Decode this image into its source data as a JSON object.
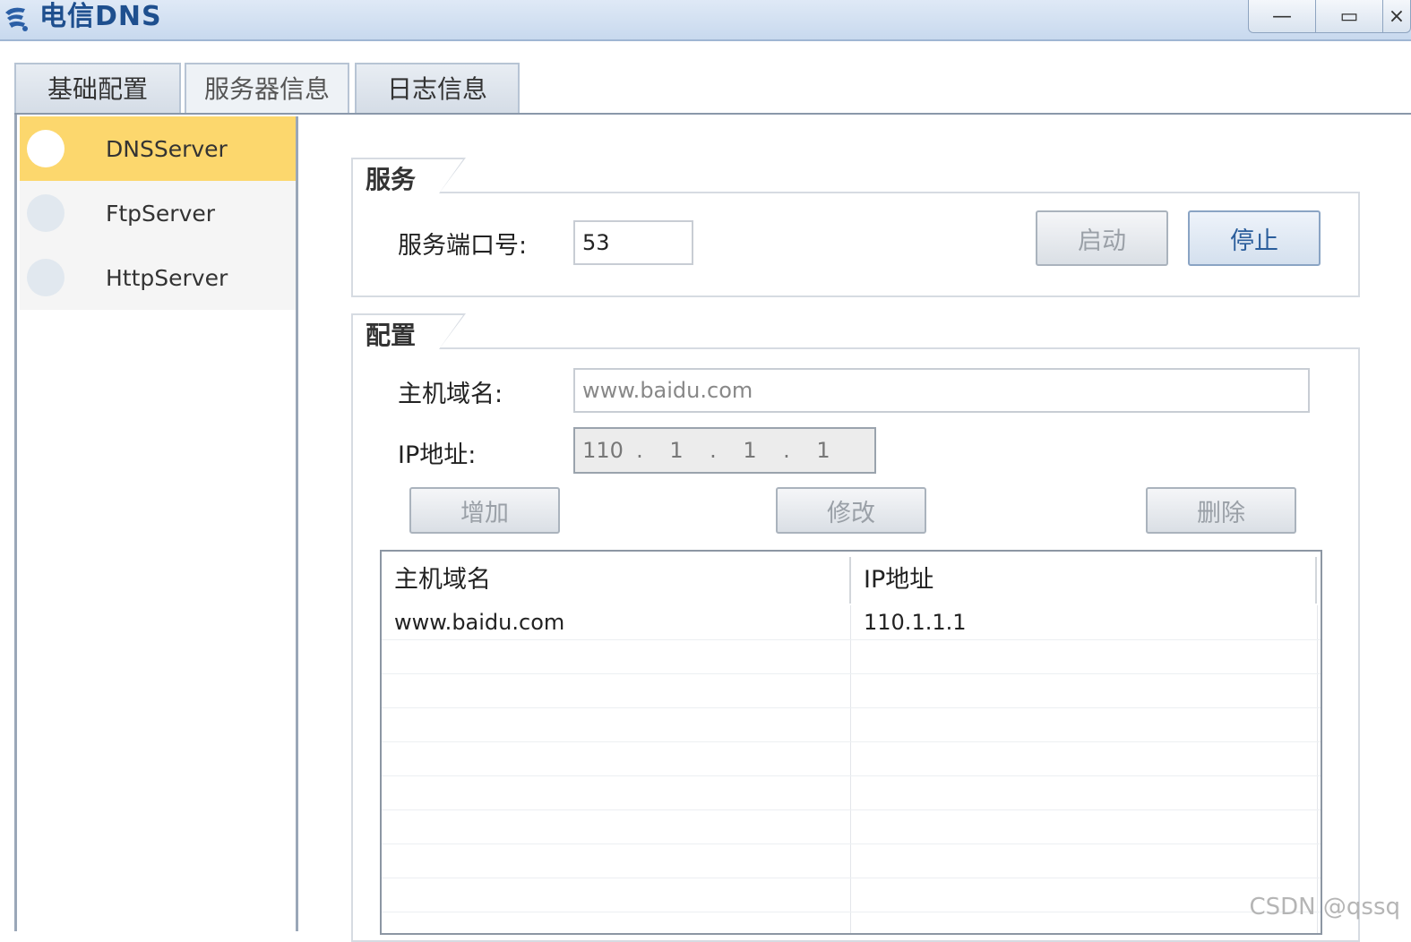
{
  "window": {
    "title": "电信DNS",
    "minimize_glyph": "—",
    "maximize_glyph": "▭",
    "close_glyph": "×"
  },
  "tabs": [
    {
      "label": "基础配置"
    },
    {
      "label": "服务器信息"
    },
    {
      "label": "日志信息"
    }
  ],
  "sidebar": {
    "items": [
      {
        "label": "DNSServer",
        "active": true
      },
      {
        "label": "FtpServer"
      },
      {
        "label": "HttpServer"
      }
    ]
  },
  "service": {
    "group_title": "服务",
    "port_label": "服务端口号:",
    "port_value": "53",
    "start_label": "启动",
    "stop_label": "停止"
  },
  "config": {
    "group_title": "配置",
    "host_label": "主机域名:",
    "host_value": "www.baidu.com",
    "ip_label": "IP地址:",
    "ip": [
      "110",
      "1",
      "1",
      "1"
    ],
    "add_label": "增加",
    "modify_label": "修改",
    "delete_label": "删除"
  },
  "table": {
    "headers": [
      "主机域名",
      "IP地址"
    ],
    "rows": [
      {
        "host": "www.baidu.com",
        "ip": "110.1.1.1"
      }
    ]
  },
  "watermark": "CSDN @qssq",
  "colors": {
    "active_sidebar": "#fcd76d",
    "title_text": "#1e4f8e",
    "stop_button_text": "#2a5d9b"
  }
}
